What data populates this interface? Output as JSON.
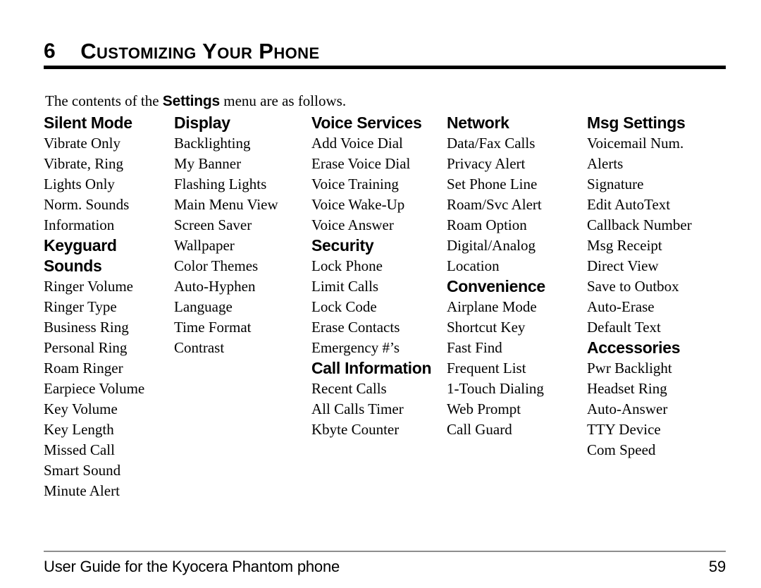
{
  "chapter": {
    "number": "6",
    "title": "Customizing Your Phone"
  },
  "intro": {
    "before": "The contents of the",
    "keyword": "Settings",
    "after": "menu are as follows."
  },
  "columns": [
    {
      "groups": [
        {
          "heading": "Silent Mode",
          "items": [
            "Vibrate Only",
            "Vibrate, Ring",
            "Lights Only",
            "Norm. Sounds",
            "Information"
          ]
        },
        {
          "heading": "Keyguard",
          "items": []
        },
        {
          "heading": "Sounds",
          "items": [
            "Ringer Volume",
            "Ringer Type",
            "Business Ring",
            "Personal Ring",
            "Roam Ringer",
            "Earpiece Volume",
            "Key Volume",
            "Key Length",
            "Missed Call",
            "Smart Sound",
            "Minute Alert"
          ]
        }
      ]
    },
    {
      "groups": [
        {
          "heading": "Display",
          "items": [
            "Backlighting",
            "My Banner",
            "Flashing Lights",
            "Main Menu View",
            "Screen Saver",
            "Wallpaper",
            "Color Themes",
            "Auto-Hyphen",
            "Language",
            "Time Format",
            "Contrast"
          ]
        }
      ]
    },
    {
      "groups": [
        {
          "heading": "Voice Services",
          "items": [
            "Add Voice Dial",
            "Erase Voice Dial",
            "Voice Training",
            "Voice Wake-Up",
            "Voice Answer"
          ]
        },
        {
          "heading": "Security",
          "items": [
            "Lock Phone",
            "Limit Calls",
            "Lock Code",
            "Erase Contacts",
            "Emergency #’s"
          ]
        },
        {
          "heading": "Call Information",
          "items": [
            "Recent Calls",
            "All Calls Timer",
            "Kbyte Counter"
          ]
        }
      ]
    },
    {
      "groups": [
        {
          "heading": "Network",
          "items": [
            "Data/Fax Calls",
            "Privacy Alert",
            "Set Phone Line",
            "Roam/Svc Alert",
            "Roam Option",
            "Digital/Analog",
            "Location"
          ]
        },
        {
          "heading": "Convenience",
          "items": [
            "Airplane Mode",
            "Shortcut Key",
            "Fast Find",
            "Frequent List",
            "1-Touch Dialing",
            "Web Prompt",
            "Call Guard"
          ]
        }
      ]
    },
    {
      "groups": [
        {
          "heading": "Msg Settings",
          "items": [
            "Voicemail Num.",
            "Alerts",
            "Signature",
            "Edit AutoText",
            "Callback Number",
            "Msg Receipt",
            "Direct View",
            "Save to Outbox",
            "Auto-Erase",
            "Default Text"
          ]
        },
        {
          "heading": "Accessories",
          "items": [
            "Pwr Backlight",
            "Headset Ring",
            "Auto-Answer",
            "TTY Device",
            "Com Speed"
          ]
        }
      ]
    }
  ],
  "footer": {
    "text": "User Guide for the Kyocera Phantom phone",
    "page": "59"
  },
  "colors": {
    "text": "#000000",
    "header_rule": "#000000",
    "footer_rule": "#8e8e8e",
    "background": "#ffffff"
  }
}
